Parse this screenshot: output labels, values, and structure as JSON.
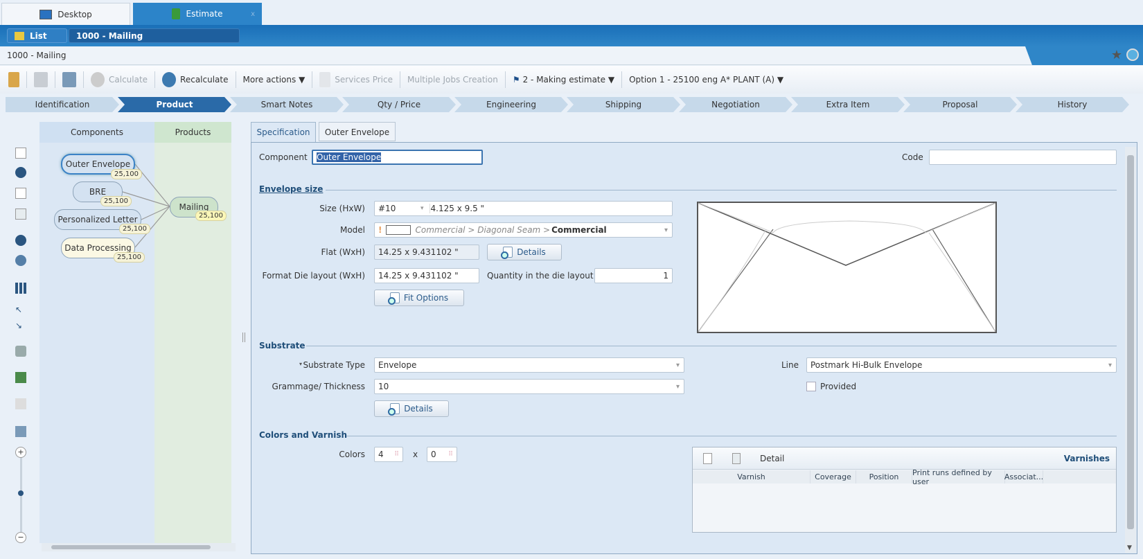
{
  "window_tabs": [
    {
      "label": "Desktop",
      "icon": "monitor-icon"
    },
    {
      "label": "Estimate",
      "icon": "estimate-icon",
      "close": "x"
    }
  ],
  "topbar": {
    "list_label": "List",
    "title": "1000 - Mailing"
  },
  "breadcrumb": "1000 - Mailing",
  "toolbar": {
    "calculate": "Calculate",
    "recalculate": "Recalculate",
    "more_actions": "More actions ▼",
    "services_price": "Services Price",
    "multiple_jobs": "Multiple Jobs Creation",
    "status": "2 - Making estimate ▼",
    "option": "Option 1 - 25100 eng A* PLANT (A) ▼"
  },
  "steps": [
    "Identification",
    "Product",
    "Smart Notes",
    "Qty / Price",
    "Engineering",
    "Shipping",
    "Negotiation",
    "Extra Item",
    "Proposal",
    "History"
  ],
  "tree": {
    "components_header": "Components",
    "products_header": "Products",
    "components": [
      {
        "label": "Outer Envelope",
        "qty": "25,100"
      },
      {
        "label": "BRE",
        "qty": "25,100"
      },
      {
        "label": "Personalized Letter",
        "qty": "25,100"
      },
      {
        "label": "Data Processing",
        "qty": "25,100"
      }
    ],
    "product": {
      "label": "Mailing",
      "qty": "25,100"
    }
  },
  "form": {
    "tabs": [
      "Specification",
      "Outer Envelope"
    ],
    "component_label": "Component",
    "component_value": "Outer Envelope",
    "code_label": "Code",
    "code_value": "",
    "envelope_size": "Envelope size",
    "size_label": "Size (HxW)",
    "size_code": "#10",
    "size_value": "4.125 x 9.5 \"",
    "model_label": "Model",
    "model_path": "Commercial > Diagonal Seam > ",
    "model_value": "Commercial",
    "flat_label": "Flat (WxH)",
    "flat_value": "14.25 x 9.431102 \"",
    "details": "Details",
    "die_label": "Format Die layout (WxH)",
    "die_value": "14.25 x 9.431102 \"",
    "qty_die_label": "Quantity in the die layout",
    "qty_die_value": "1",
    "fit_options": "Fit Options",
    "substrate": "Substrate",
    "substrate_type_label": "Substrate Type",
    "substrate_type_value": "Envelope",
    "grammage_label": "Grammage/ Thickness",
    "grammage_value": "10",
    "line_label": "Line",
    "line_value": "Postmark Hi-Bulk Envelope",
    "provided": "Provided",
    "colors_section": "Colors and Varnish",
    "colors_label": "Colors",
    "colors_front": "4",
    "colors_x": "x",
    "colors_back": "0",
    "varnish": {
      "detail": "Detail",
      "title": "Varnishes",
      "columns": [
        "Varnish",
        "Coverage",
        "Position",
        "Print runs defined by user",
        "Associat..."
      ]
    }
  }
}
